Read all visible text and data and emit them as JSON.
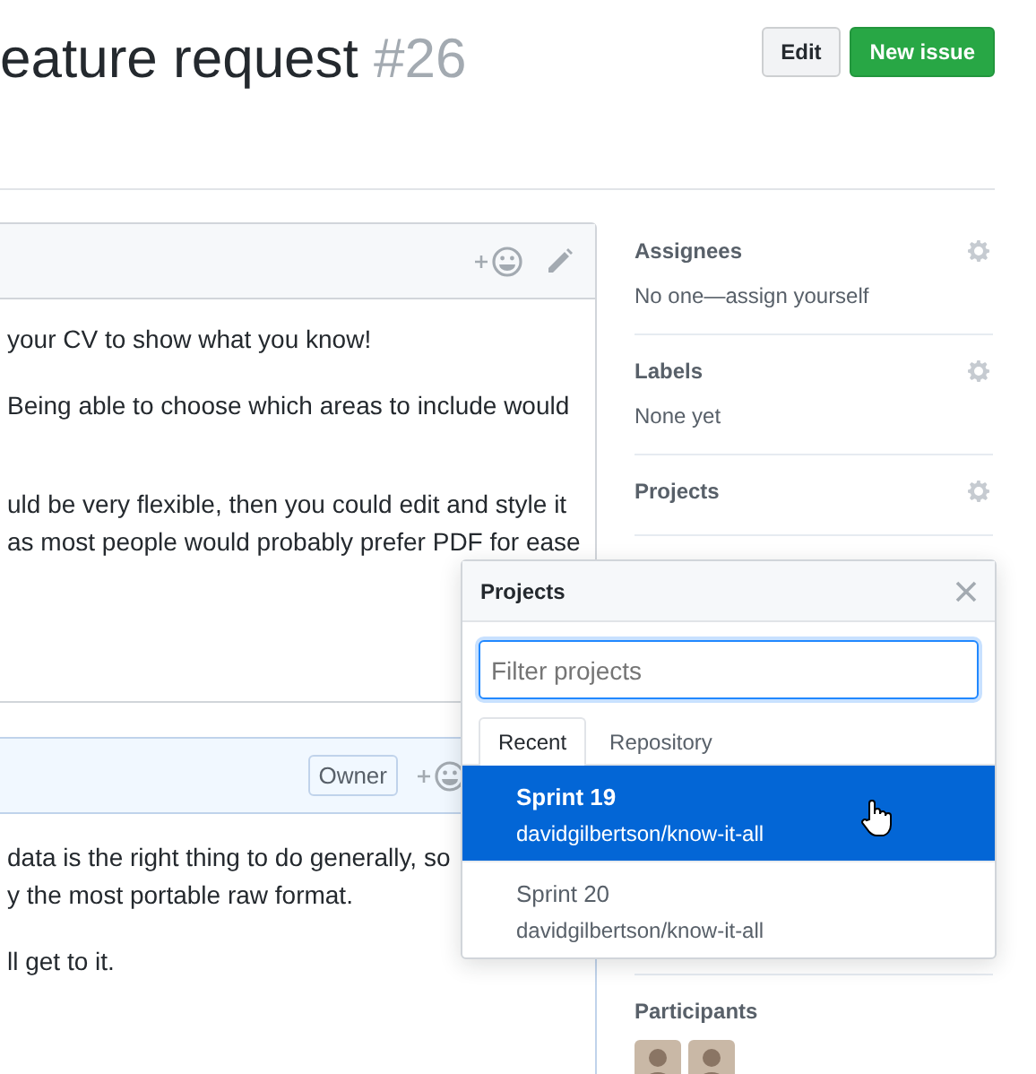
{
  "header": {
    "title": "eature request",
    "number": "#26",
    "buttons": [
      {
        "label": "Edit",
        "kind": "default"
      },
      {
        "label": "New issue",
        "kind": "primary"
      }
    ]
  },
  "comments": [
    {
      "kind": "plain",
      "paragraphs": [
        [
          "your CV to show what you know!"
        ],
        [
          "Being able to choose which areas to include would"
        ],
        [
          "uld be very flexible, then you could edit and style it",
          "as most people would probably prefer PDF for ease"
        ]
      ]
    },
    {
      "kind": "owner",
      "badge": "Owner",
      "paragraphs": [
        [
          "data is the right thing to do generally, so",
          "y the most portable raw format."
        ],
        [
          "ll get to it."
        ]
      ]
    }
  ],
  "sidebar": {
    "sections": [
      {
        "title": "Assignees",
        "value": "No one—assign yourself",
        "kind": "setting"
      },
      {
        "title": "Labels",
        "value": "None yet",
        "kind": "setting"
      },
      {
        "title": "Projects",
        "kind": "setting"
      },
      {
        "title": "Participants",
        "kind": "list",
        "avatars": [
          {
            "kind": "avatar"
          },
          {
            "kind": "avatar"
          }
        ]
      }
    ]
  },
  "projects_menu": {
    "title": "Projects",
    "filter": {
      "placeholder": "Filter projects"
    },
    "tabs": [
      {
        "label": "Recent",
        "selected": true
      },
      {
        "label": "Repository",
        "selected": false
      }
    ],
    "items": [
      {
        "name": "Sprint 19",
        "repo": "davidgilbertson/know-it-all",
        "selected": true
      },
      {
        "name": "Sprint 20",
        "repo": "davidgilbertson/know-it-all",
        "selected": false
      }
    ]
  }
}
